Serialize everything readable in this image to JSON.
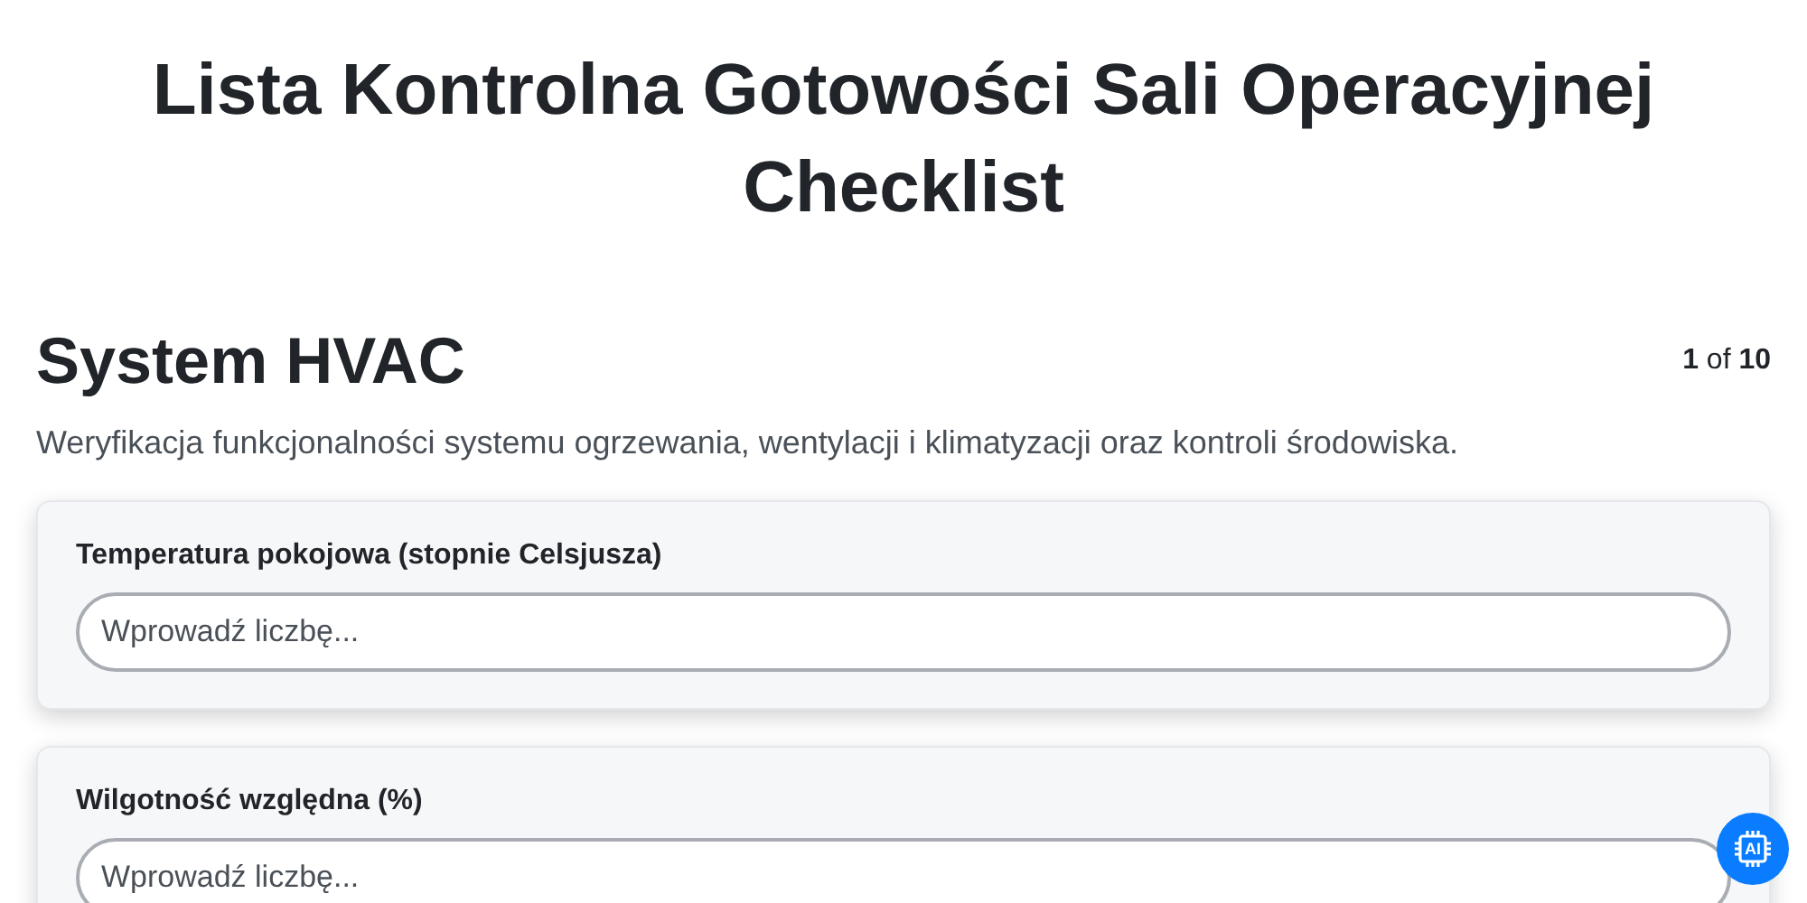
{
  "title": "Lista Kontrolna Gotowości Sali Operacyjnej Checklist",
  "section": {
    "heading": "System HVAC",
    "progress": "**1** of **10**",
    "description": "Weryfikacja funkcjonalności systemu ogrzewania, wentylacji i klimatyzacji oraz kontroli środowiska."
  },
  "fields": [
    {
      "label": "Temperatura pokojowa (stopnie Celsjusza)",
      "placeholder": "Wprowadź liczbę..."
    },
    {
      "label": "Wilgotność względna (%)",
      "placeholder": "Wprowadź liczbę..."
    }
  ],
  "ai_button": {
    "label": "AI"
  }
}
